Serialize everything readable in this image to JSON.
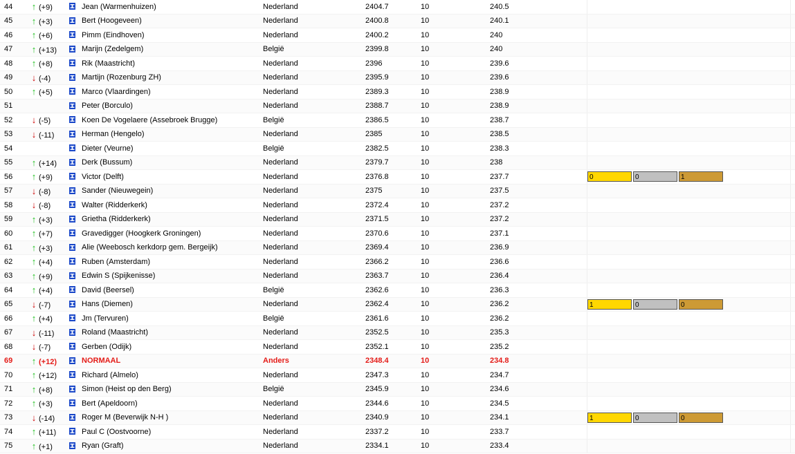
{
  "colors": {
    "up": "#22c022",
    "down": "#cc0000",
    "highlight": "#e41b17",
    "gold": "#ffd700",
    "silver": "#c0c0c0",
    "bronze": "#cd9a35"
  },
  "rows": [
    {
      "rank": "44",
      "dir": "up",
      "change": "(+9)",
      "name": "Jean (Warmenhuizen)",
      "country": "Nederland",
      "score": "2404.7",
      "games": "10",
      "avg": "240.5"
    },
    {
      "rank": "45",
      "dir": "up",
      "change": "(+3)",
      "name": "Bert (Hoogeveen)",
      "country": "Nederland",
      "score": "2400.8",
      "games": "10",
      "avg": "240.1"
    },
    {
      "rank": "46",
      "dir": "up",
      "change": "(+6)",
      "name": "Pimm (Eindhoven)",
      "country": "Nederland",
      "score": "2400.2",
      "games": "10",
      "avg": "240"
    },
    {
      "rank": "47",
      "dir": "up",
      "change": "(+13)",
      "name": "Marijn (Zedelgem)",
      "country": "België",
      "score": "2399.8",
      "games": "10",
      "avg": "240"
    },
    {
      "rank": "48",
      "dir": "up",
      "change": "(+8)",
      "name": "Rik (Maastricht)",
      "country": "Nederland",
      "score": "2396",
      "games": "10",
      "avg": "239.6"
    },
    {
      "rank": "49",
      "dir": "down",
      "change": "(-4)",
      "name": "Martijn (Rozenburg ZH)",
      "country": "Nederland",
      "score": "2395.9",
      "games": "10",
      "avg": "239.6"
    },
    {
      "rank": "50",
      "dir": "up",
      "change": "(+5)",
      "name": "Marco (Vlaardingen)",
      "country": "Nederland",
      "score": "2389.3",
      "games": "10",
      "avg": "238.9"
    },
    {
      "rank": "51",
      "dir": "none",
      "change": "",
      "name": "Peter (Borculo)",
      "country": "Nederland",
      "score": "2388.7",
      "games": "10",
      "avg": "238.9"
    },
    {
      "rank": "52",
      "dir": "down",
      "change": "(-5)",
      "name": "Koen De Vogelaere (Assebroek Brugge)",
      "country": "België",
      "score": "2386.5",
      "games": "10",
      "avg": "238.7"
    },
    {
      "rank": "53",
      "dir": "down",
      "change": "(-11)",
      "name": "Herman (Hengelo)",
      "country": "Nederland",
      "score": "2385",
      "games": "10",
      "avg": "238.5"
    },
    {
      "rank": "54",
      "dir": "none",
      "change": "",
      "name": "Dieter (Veurne)",
      "country": "België",
      "score": "2382.5",
      "games": "10",
      "avg": "238.3"
    },
    {
      "rank": "55",
      "dir": "up",
      "change": "(+14)",
      "name": "Derk (Bussum)",
      "country": "Nederland",
      "score": "2379.7",
      "games": "10",
      "avg": "238"
    },
    {
      "rank": "56",
      "dir": "up",
      "change": "(+9)",
      "name": "Victor (Delft)",
      "country": "Nederland",
      "score": "2376.8",
      "games": "10",
      "avg": "237.7",
      "medals": [
        "0",
        "0",
        "1"
      ]
    },
    {
      "rank": "57",
      "dir": "down",
      "change": "(-8)",
      "name": "Sander (Nieuwegein)",
      "country": "Nederland",
      "score": "2375",
      "games": "10",
      "avg": "237.5"
    },
    {
      "rank": "58",
      "dir": "down",
      "change": "(-8)",
      "name": "Walter (Ridderkerk)",
      "country": "Nederland",
      "score": "2372.4",
      "games": "10",
      "avg": "237.2"
    },
    {
      "rank": "59",
      "dir": "up",
      "change": "(+3)",
      "name": "Grietha (Ridderkerk)",
      "country": "Nederland",
      "score": "2371.5",
      "games": "10",
      "avg": "237.2"
    },
    {
      "rank": "60",
      "dir": "up",
      "change": "(+7)",
      "name": "Gravedigger (Hoogkerk Groningen)",
      "country": "Nederland",
      "score": "2370.6",
      "games": "10",
      "avg": "237.1"
    },
    {
      "rank": "61",
      "dir": "up",
      "change": "(+3)",
      "name": "Alie (Weebosch kerkdorp gem. Bergeijk)",
      "country": "Nederland",
      "score": "2369.4",
      "games": "10",
      "avg": "236.9"
    },
    {
      "rank": "62",
      "dir": "up",
      "change": "(+4)",
      "name": "Ruben (Amsterdam)",
      "country": "Nederland",
      "score": "2366.2",
      "games": "10",
      "avg": "236.6"
    },
    {
      "rank": "63",
      "dir": "up",
      "change": "(+9)",
      "name": "Edwin S (Spijkenisse)",
      "country": "Nederland",
      "score": "2363.7",
      "games": "10",
      "avg": "236.4"
    },
    {
      "rank": "64",
      "dir": "up",
      "change": "(+4)",
      "name": "David (Beersel)",
      "country": "België",
      "score": "2362.6",
      "games": "10",
      "avg": "236.3"
    },
    {
      "rank": "65",
      "dir": "down",
      "change": "(-7)",
      "name": "Hans (Diemen)",
      "country": "Nederland",
      "score": "2362.4",
      "games": "10",
      "avg": "236.2",
      "medals": [
        "1",
        "0",
        "0"
      ]
    },
    {
      "rank": "66",
      "dir": "up",
      "change": "(+4)",
      "name": "Jm (Tervuren)",
      "country": "België",
      "score": "2361.6",
      "games": "10",
      "avg": "236.2"
    },
    {
      "rank": "67",
      "dir": "down",
      "change": "(-11)",
      "name": "Roland (Maastricht)",
      "country": "Nederland",
      "score": "2352.5",
      "games": "10",
      "avg": "235.3"
    },
    {
      "rank": "68",
      "dir": "down",
      "change": "(-7)",
      "name": "Gerben (Odijk)",
      "country": "Nederland",
      "score": "2352.1",
      "games": "10",
      "avg": "235.2"
    },
    {
      "rank": "69",
      "dir": "up",
      "change": "(+12)",
      "name": "NORMAAL",
      "country": "Anders",
      "score": "2348.4",
      "games": "10",
      "avg": "234.8",
      "highlight": true
    },
    {
      "rank": "70",
      "dir": "up",
      "change": "(+12)",
      "name": "Richard (Almelo)",
      "country": "Nederland",
      "score": "2347.3",
      "games": "10",
      "avg": "234.7"
    },
    {
      "rank": "71",
      "dir": "up",
      "change": "(+8)",
      "name": "Simon (Heist op den Berg)",
      "country": "België",
      "score": "2345.9",
      "games": "10",
      "avg": "234.6"
    },
    {
      "rank": "72",
      "dir": "up",
      "change": "(+3)",
      "name": "Bert (Apeldoorn)",
      "country": "Nederland",
      "score": "2344.6",
      "games": "10",
      "avg": "234.5"
    },
    {
      "rank": "73",
      "dir": "down",
      "change": "(-14)",
      "name": "Roger M (Beverwijk N-H )",
      "country": "Nederland",
      "score": "2340.9",
      "games": "10",
      "avg": "234.1",
      "medals": [
        "1",
        "0",
        "0"
      ]
    },
    {
      "rank": "74",
      "dir": "up",
      "change": "(+11)",
      "name": "Paul C (Oostvoorne)",
      "country": "Nederland",
      "score": "2337.2",
      "games": "10",
      "avg": "233.7"
    },
    {
      "rank": "75",
      "dir": "up",
      "change": "(+1)",
      "name": "Ryan (Graft)",
      "country": "Nederland",
      "score": "2334.1",
      "games": "10",
      "avg": "233.4"
    }
  ]
}
